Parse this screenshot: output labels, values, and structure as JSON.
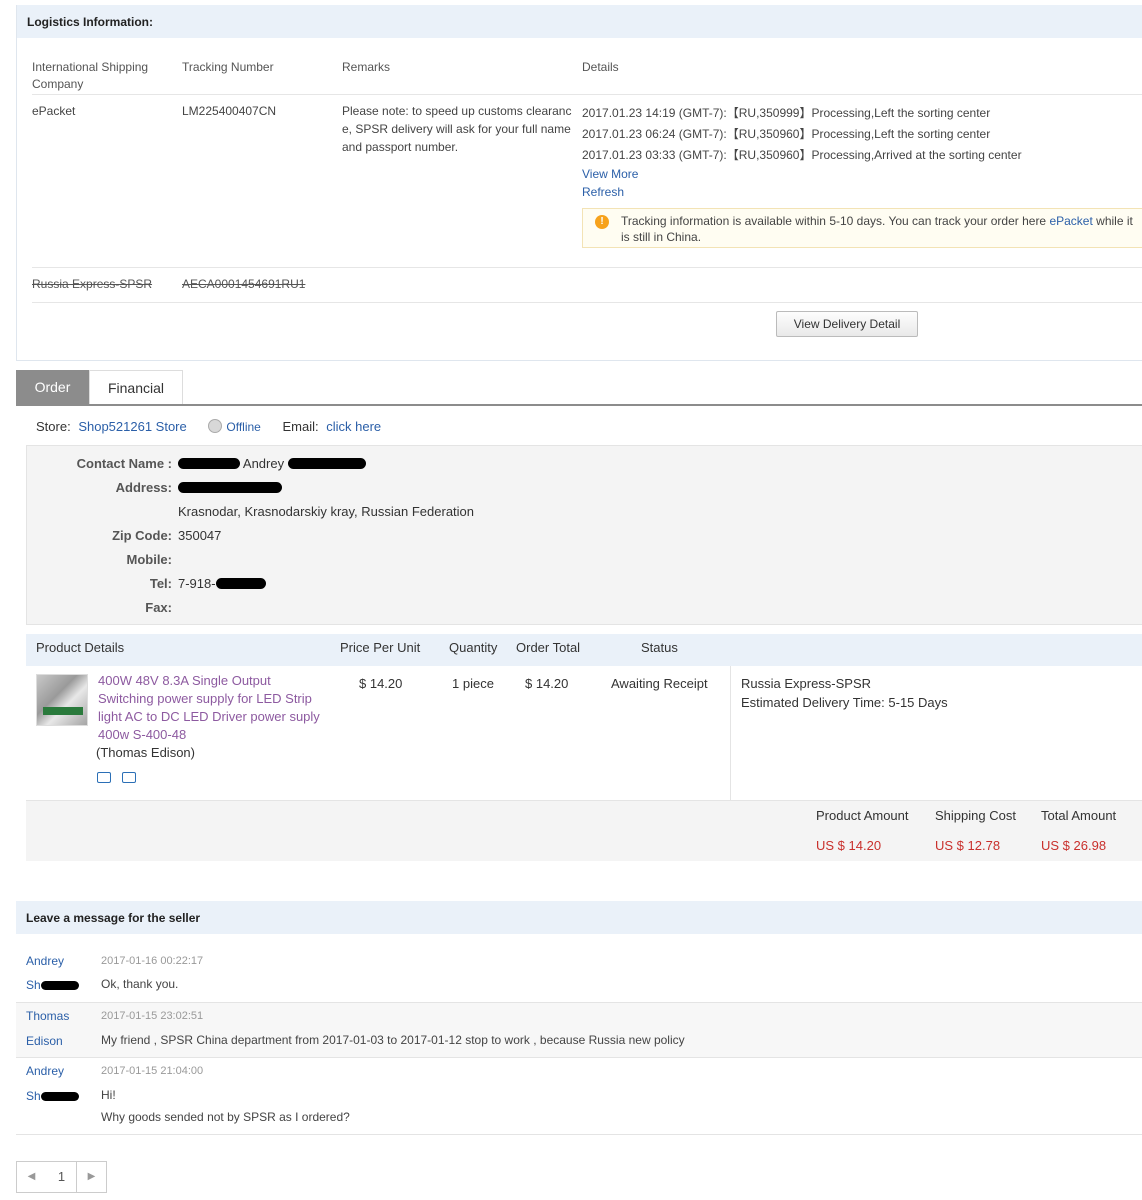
{
  "logistics": {
    "title": "Logistics Information:",
    "headers": {
      "company": "International Shipping Company",
      "tracking": "Tracking Number",
      "remarks": "Remarks",
      "details": "Details"
    },
    "row1": {
      "company": "ePacket",
      "tracking": "LM225400407CN",
      "remarks": "Please note: to speed up customs clearance, SPSR delivery will ask for your full name and passport number.",
      "details": [
        "2017.01.23 14:19 (GMT-7):【RU,350999】Processing,Left the sorting center",
        "2017.01.23 06:24 (GMT-7):【RU,350960】Processing,Left the sorting center",
        "2017.01.23 03:33 (GMT-7):【RU,350960】Processing,Arrived at the sorting center"
      ],
      "view_more": "View More",
      "refresh": "Refresh",
      "tip_prefix": "Tracking information is available within 5-10 days. You can track your order here ",
      "tip_link": "ePacket",
      "tip_suffix": " while it is still in China."
    },
    "row2": {
      "company": "Russia Express-SPSR",
      "tracking": "AECA0001454691RU1"
    },
    "view_delivery_button": "View Delivery Detail"
  },
  "tabs": {
    "order": "Order",
    "financial": "Financial"
  },
  "store": {
    "label": "Store:",
    "name": "Shop521261 Store",
    "status": "Offline",
    "email_label": "Email:",
    "email_link": "click here"
  },
  "address": {
    "contact_label": "Contact Name :",
    "contact_visible": "Andrey",
    "address_label": "Address:",
    "city_line": "Krasnodar, Krasnodarskiy kray, Russian Federation",
    "zip_label": "Zip Code:",
    "zip": "350047",
    "mobile_label": "Mobile:",
    "tel_label": "Tel:",
    "tel_prefix": "7-918-",
    "fax_label": "Fax:"
  },
  "products": {
    "headers": {
      "details": "Product Details",
      "price": "Price Per Unit",
      "quantity": "Quantity",
      "total": "Order Total",
      "status": "Status"
    },
    "item": {
      "name": "400W 48V 8.3A Single Output Switching power supply for LED Strip light AC to DC LED Driver power suply 400w S-400-48",
      "seller": "(Thomas Edison)",
      "price": "$ 14.20",
      "quantity": "1 piece",
      "total": "$ 14.20",
      "status": "Awaiting Receipt",
      "shipping_method": "Russia Express-SPSR",
      "delivery_label": "Estimated Delivery Time:",
      "delivery_time": "5-15 Days"
    },
    "icons": [
      "truck-icon",
      "card-icon"
    ]
  },
  "totals": {
    "product_amount_label": "Product Amount",
    "product_amount": "US $ 14.20",
    "shipping_cost_label": "Shipping Cost",
    "shipping_cost": "US $ 12.78",
    "total_amount_label": "Total Amount",
    "total_amount": "US $ 26.98"
  },
  "messages": {
    "title": "Leave a message for the seller",
    "items": [
      {
        "name1": "Andrey",
        "name2": "Sh",
        "time": "2017-01-16 00:22:17",
        "lines": [
          "Ok, thank you."
        ]
      },
      {
        "name1": "Thomas",
        "name2": "Edison",
        "time": "2017-01-15 23:02:51",
        "lines": [
          "My friend , SPSR China department from 2017-01-03 to 2017-01-12 stop to work , because Russia new policy"
        ]
      },
      {
        "name1": "Andrey",
        "name2": "Sh",
        "time": "2017-01-15 21:04:00",
        "lines": [
          "Hi!",
          "Why goods sended not by SPSR as I ordered?"
        ]
      }
    ]
  },
  "pagination": {
    "current": "1",
    "prev": "◀",
    "next": "▶"
  }
}
